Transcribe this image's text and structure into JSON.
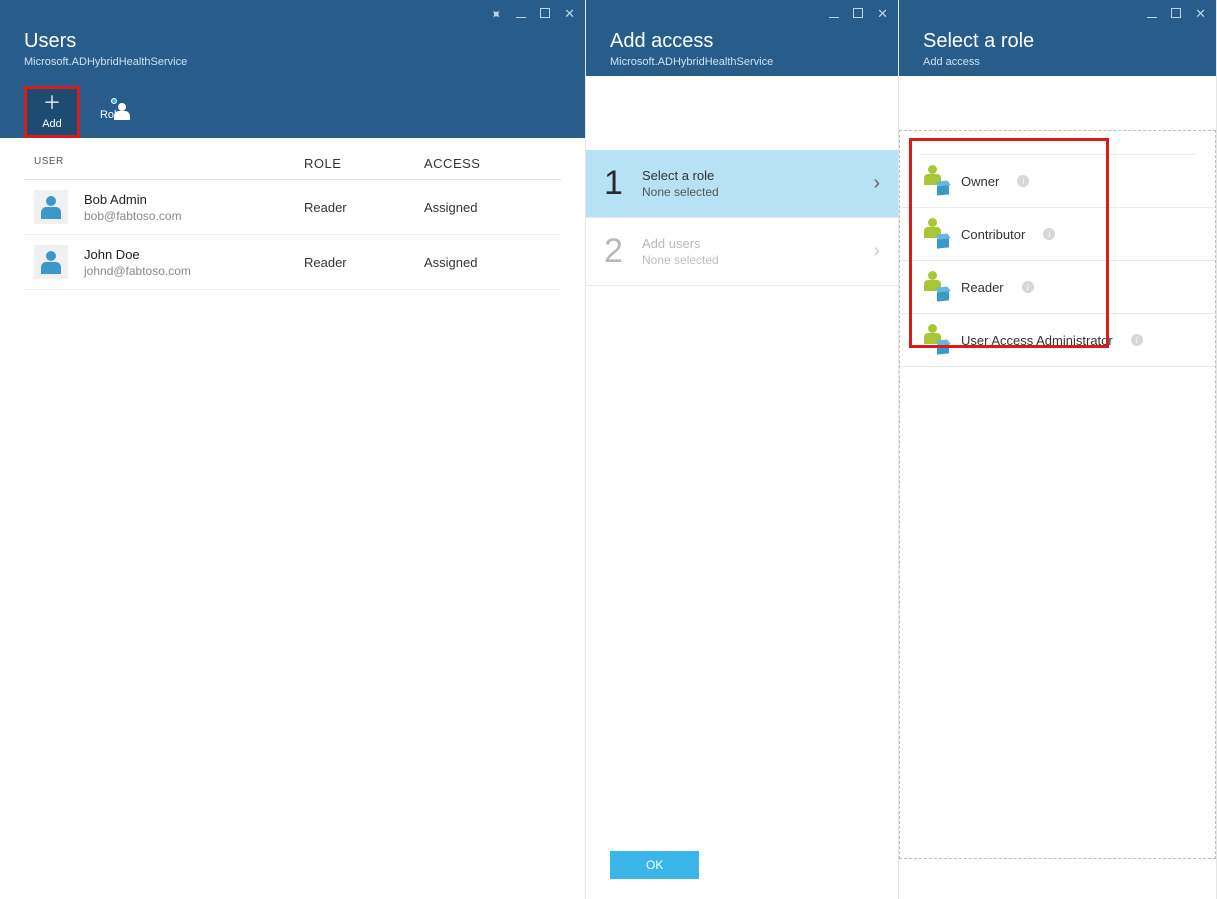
{
  "users_blade": {
    "title": "Users",
    "subtitle": "Microsoft.ADHybridHealthService",
    "toolbar": {
      "add": "Add",
      "roles": "Roles"
    },
    "columns": {
      "user": "USER",
      "role": "ROLE",
      "access": "ACCESS"
    },
    "rows": [
      {
        "name": "Bob Admin",
        "email": "bob@fabtoso.com",
        "role": "Reader",
        "access": "Assigned"
      },
      {
        "name": "John Doe",
        "email": "johnd@fabtoso.com",
        "role": "Reader",
        "access": "Assigned"
      }
    ]
  },
  "add_blade": {
    "title": "Add access",
    "subtitle": "Microsoft.ADHybridHealthService",
    "steps": [
      {
        "num": "1",
        "title": "Select a role",
        "sub": "None selected",
        "active": true
      },
      {
        "num": "2",
        "title": "Add users",
        "sub": "None selected",
        "active": false
      }
    ],
    "ok": "OK"
  },
  "role_blade": {
    "title": "Select a role",
    "subtitle": "Add access",
    "roles": [
      {
        "label": "Owner"
      },
      {
        "label": "Contributor"
      },
      {
        "label": "Reader"
      },
      {
        "label": "User Access Administrator"
      }
    ]
  }
}
